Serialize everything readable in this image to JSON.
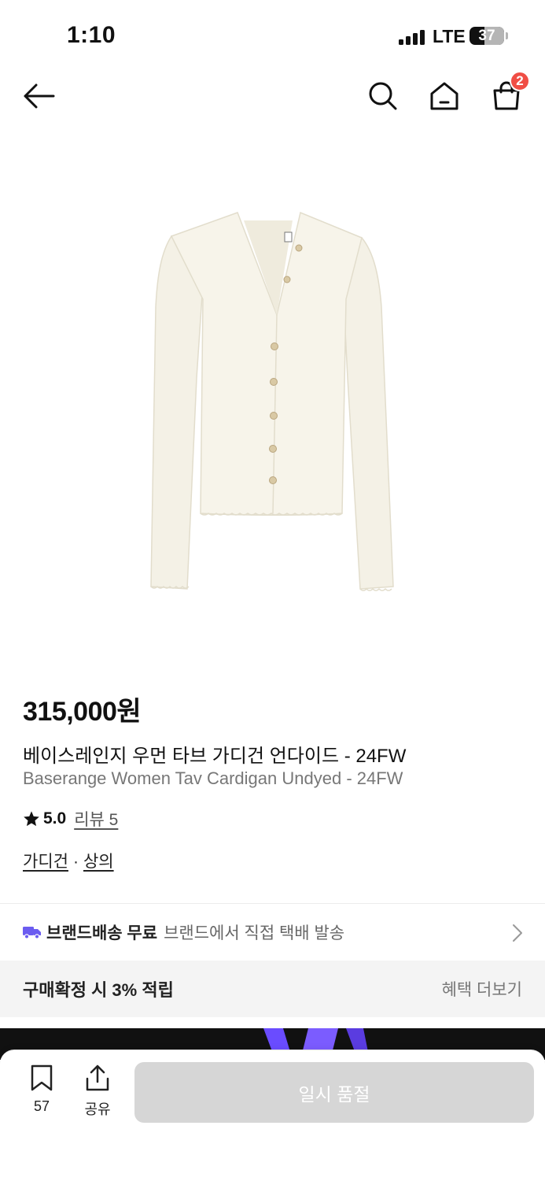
{
  "status_bar": {
    "time": "1:10",
    "network": "LTE",
    "battery": "37"
  },
  "nav": {
    "back_icon": "arrow-left-icon",
    "search_icon": "search-icon",
    "home_icon": "home-icon",
    "cart_icon": "shopping-bag-icon",
    "cart_count": "2"
  },
  "product": {
    "image": "cream-ribbed-cardigan-image",
    "price": "315,000원",
    "title_ko": "베이스레인지 우먼 타브 가디건 언다이드 - 24FW",
    "title_en": "Baserange Women Tav Cardigan Undyed - 24FW",
    "rating_score": "5.0",
    "review_link": "리뷰 5",
    "categories": [
      "가디건",
      "상의"
    ],
    "category_separator": "·"
  },
  "shipping": {
    "icon": "truck-icon",
    "label": "브랜드배송 무료",
    "detail": "브랜드에서 직접 택배 발송",
    "chevron": "chevron-right-icon"
  },
  "benefit": {
    "title": "구매확정 시 3% 적립",
    "more": "혜택 더보기"
  },
  "bottom_bar": {
    "bookmark_count": "57",
    "share_label": "공유",
    "primary_button": "일시 품절"
  },
  "colors": {
    "badge": "#f04e45",
    "truck": "#6b5cf0",
    "disabled_button": "#d6d6d6",
    "benefit_bg": "#f4f4f4"
  }
}
